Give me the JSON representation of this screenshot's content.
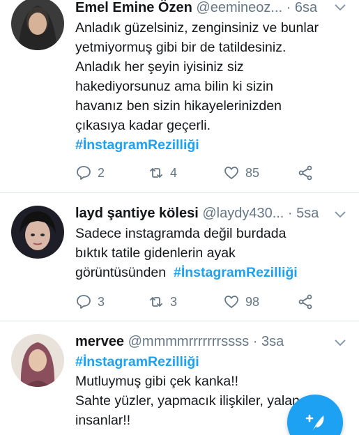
{
  "tweets": [
    {
      "name": "Emel Emine Özen",
      "handle": "@eemineoz...",
      "time": "6sa",
      "lines": [
        "Anladık güzelsiniz, zenginsiniz ve bunlar",
        "yetmiyormuş gibi bir de tatildesiniz.",
        "Anladık her şeyin iyisiniz siz",
        "hakediyorsunuz ama bilin ki sizin",
        "havanız ben sizin hikayelerinizden",
        "çıkasıya kadar geçerli."
      ],
      "hashtag": "#İnstagramRezilliği",
      "replies": "2",
      "retweets": "4",
      "likes": "85"
    },
    {
      "name": "layd şantiye kölesi",
      "handle": "@laydy430...",
      "time": "5sa",
      "lines": [
        "Sadece instagramda değil burdada",
        "bıktık tatile gidenlerin ayak"
      ],
      "last_line_text": "görüntüsünden",
      "hashtag": "#İnstagramRezilliği",
      "replies": "3",
      "retweets": "3",
      "likes": "98"
    },
    {
      "name": "mervee",
      "handle": "@mmmmrrrrrrrssss",
      "time": "3sa",
      "hashtag": "#İnstagramRezilliği",
      "lines": [
        "Mutluymuş gibi çek kanka!!",
        "Sahte yüzler, yapmacık ilişkiler, yalancı",
        "insanlar!!"
      ]
    }
  ],
  "separator": "·",
  "icons": {
    "reply": "reply-icon",
    "retweet": "retweet-icon",
    "like": "heart-icon",
    "share": "share-icon",
    "menu": "chevron-down-icon",
    "compose": "compose-tweet-icon"
  },
  "colors": {
    "accent": "#1da1f2",
    "text": "#14171a",
    "muted": "#657786",
    "divider": "#e1e8ed"
  }
}
